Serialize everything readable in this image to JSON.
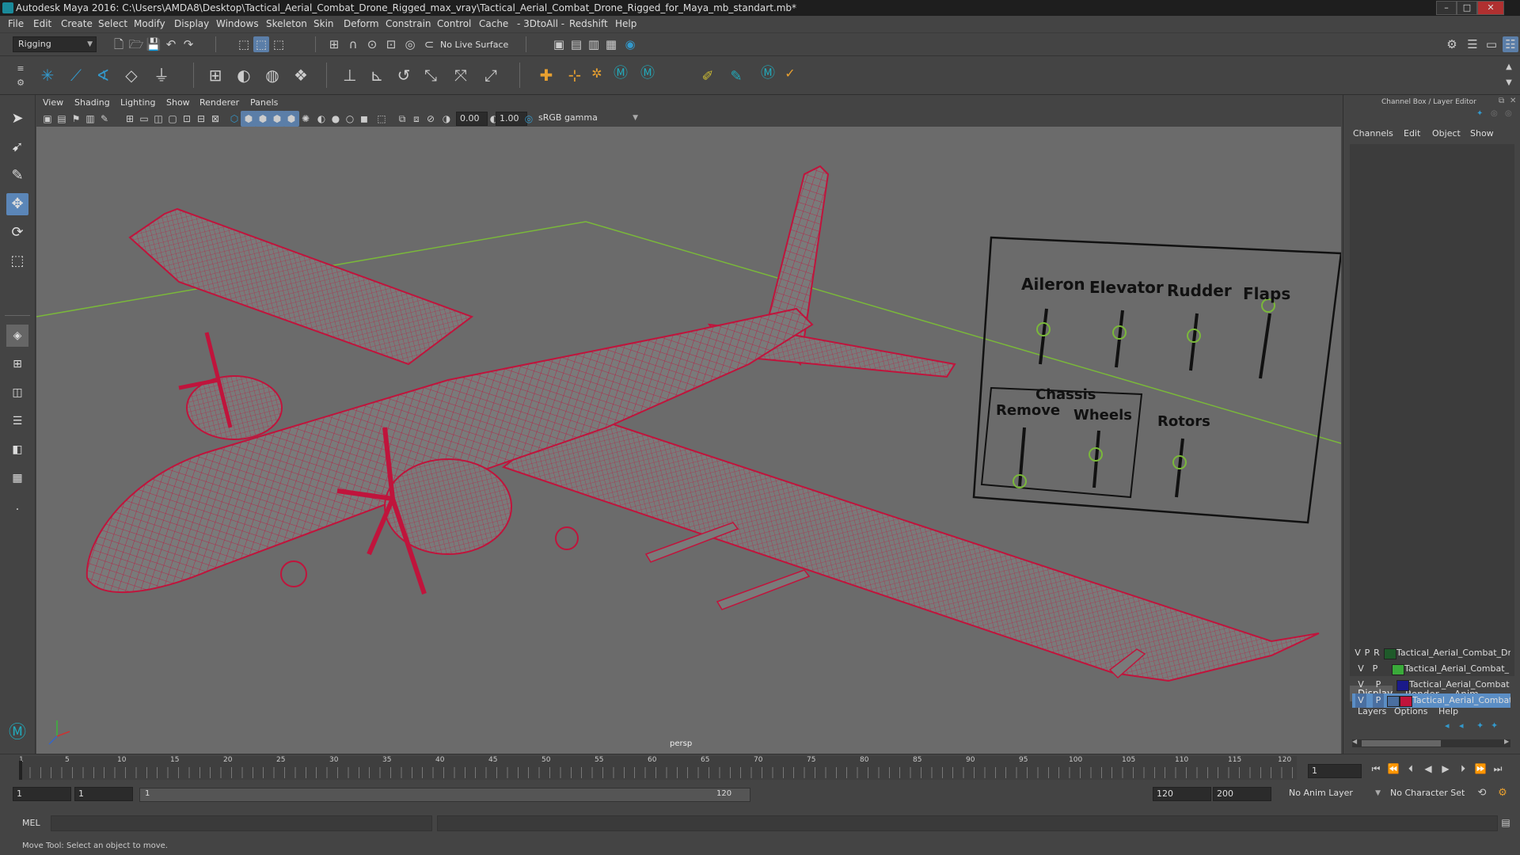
{
  "window": {
    "title": "Autodesk Maya 2016: C:\\Users\\AMDA8\\Desktop\\Tactical_Aerial_Combat_Drone_Rigged_max_vray\\Tactical_Aerial_Combat_Drone_Rigged_for_Maya_mb_standart.mb*",
    "minimize": "–",
    "maximize": "□",
    "close": "✕"
  },
  "menubar": {
    "items": [
      "File",
      "Edit",
      "Create",
      "Select",
      "Modify",
      "Display",
      "Windows",
      "Skeleton",
      "Skin",
      "Deform",
      "Constrain",
      "Control",
      "Cache",
      "- 3DtoAll -",
      "Redshift",
      "Help"
    ]
  },
  "statusline": {
    "menuset": "Rigging",
    "live_surface": "No Live Surface"
  },
  "viewport": {
    "menu": [
      "View",
      "Shading",
      "Lighting",
      "Show",
      "Renderer",
      "Panels"
    ],
    "exposure": "0.00",
    "gamma": "1.00",
    "colorspace": "sRGB gamma",
    "camera_label": "persp",
    "rig_panel": {
      "labels": [
        "Aileron",
        "Elevator",
        "Rudder",
        "Flaps",
        "Chassis",
        "Remove",
        "Wheels",
        "Rotors"
      ]
    }
  },
  "channelbox": {
    "title": "Channel Box / Layer Editor",
    "menu": [
      "Channels",
      "Edit",
      "Object",
      "Show"
    ],
    "tabs": [
      "Display",
      "Render",
      "Anim"
    ],
    "layer_menu": [
      "Layers",
      "Options",
      "Help"
    ],
    "layers": [
      {
        "v": "V",
        "p": "P",
        "r": "R",
        "name": "Tactical_Aerial_Combat_Dron",
        "color": "#1f5a2a",
        "selected": false
      },
      {
        "v": "V",
        "p": "P",
        "r": "",
        "name": "Tactical_Aerial_Combat_",
        "color": "#3aaa3a",
        "selected": false
      },
      {
        "v": "V",
        "p": "P",
        "r": "",
        "name": "Tactical_Aerial_Combat",
        "color": "#1a1a8a",
        "selected": false
      },
      {
        "v": "V",
        "p": "P",
        "r": "",
        "name": "Tactical_Aerial_Combat",
        "color": "#c0143c",
        "selected": true
      }
    ]
  },
  "timeline": {
    "ticks": [
      "1",
      "5",
      "10",
      "15",
      "20",
      "25",
      "30",
      "35",
      "40",
      "45",
      "50",
      "55",
      "60",
      "65",
      "70",
      "75",
      "80",
      "85",
      "90",
      "95",
      "100",
      "105",
      "110",
      "115",
      "120"
    ],
    "current_frame": "1"
  },
  "range": {
    "start": "1",
    "playback_start": "1",
    "range_start_label": "1",
    "range_end_label": "120",
    "playback_end": "120",
    "end": "200",
    "anim_layer": "No Anim Layer",
    "character_set": "No Character Set"
  },
  "cmdline": {
    "label": "MEL"
  },
  "helpline": {
    "text": "Move Tool: Select an object to move."
  },
  "colors": {
    "wireframe": "#c0143c",
    "grid_axis": "#7ab83a",
    "viewport_bg": "#6b6b6b",
    "selection": "#5b8ec5"
  }
}
